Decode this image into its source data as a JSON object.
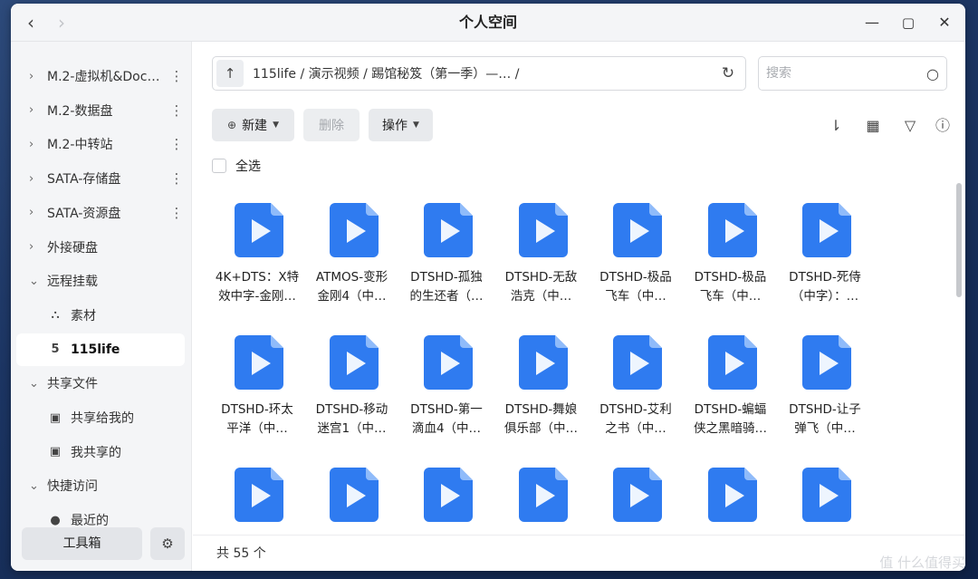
{
  "window": {
    "title": "个人空间",
    "back_icon": "chevron-left-icon",
    "forward_icon": "chevron-right-icon",
    "minimize_glyph": "—",
    "maximize_glyph": "▢",
    "close_glyph": "✕"
  },
  "sidebar": {
    "items": [
      {
        "label": "M.2-虚拟机&Doc…",
        "type": "disk"
      },
      {
        "label": "M.2-数据盘",
        "type": "disk"
      },
      {
        "label": "M.2-中转站",
        "type": "disk"
      },
      {
        "label": "SATA-存储盘",
        "type": "disk"
      },
      {
        "label": "SATA-资源盘",
        "type": "disk"
      },
      {
        "label": "外接硬盘",
        "type": "group-collapsed"
      },
      {
        "label": "远程挂载",
        "type": "group-expanded"
      },
      {
        "label": "素材",
        "type": "child"
      },
      {
        "label": "115life",
        "type": "child-active"
      },
      {
        "label": "共享文件",
        "type": "group-expanded"
      },
      {
        "label": "共享给我的",
        "type": "child"
      },
      {
        "label": "我共享的",
        "type": "child"
      },
      {
        "label": "快捷访问",
        "type": "group-expanded"
      },
      {
        "label": "最近的",
        "type": "child"
      }
    ],
    "toolbox_label": "工具箱"
  },
  "pathbar": {
    "path": "115life / 演示视频 / 踢馆秘笈（第一季）—…   /"
  },
  "search": {
    "placeholder": "搜索"
  },
  "toolbar": {
    "new_label": "新建",
    "delete_label": "删除",
    "action_label": "操作"
  },
  "select_all_label": "全选",
  "files": [
    [
      "4K+DTS：X特",
      "效中字-金刚…"
    ],
    [
      "ATMOS-变形",
      "金刚4（中…"
    ],
    [
      "DTSHD-孤独",
      "的生还者（…"
    ],
    [
      "DTSHD-无敌",
      "浩克（中…"
    ],
    [
      "DTSHD-极品",
      "飞车（中…"
    ],
    [
      "DTSHD-极品",
      "飞车（中…"
    ],
    [
      "DTSHD-死侍",
      "（中字）：…"
    ],
    [
      "DTSHD-环太",
      "平洋（中…"
    ],
    [
      "DTSHD-移动",
      "迷宫1（中…"
    ],
    [
      "DTSHD-第一",
      "滴血4（中…"
    ],
    [
      "DTSHD-舞娘",
      "俱乐部（中…"
    ],
    [
      "DTSHD-艾利",
      "之书（中…"
    ],
    [
      "DTSHD-蝙蝠",
      "侠之黑暗骑…"
    ],
    [
      "DTSHD-让子",
      "弹飞（中…"
    ],
    [
      "",
      ""
    ],
    [
      "",
      ""
    ],
    [
      "",
      ""
    ],
    [
      "",
      ""
    ],
    [
      "",
      ""
    ],
    [
      "",
      ""
    ],
    [
      "",
      ""
    ]
  ],
  "status": {
    "count_text": "共 55 个"
  },
  "watermark": "值 什么值得买",
  "colors": {
    "file_icon": "#2f7bf0",
    "file_icon_fold": "#8fbbfa"
  }
}
